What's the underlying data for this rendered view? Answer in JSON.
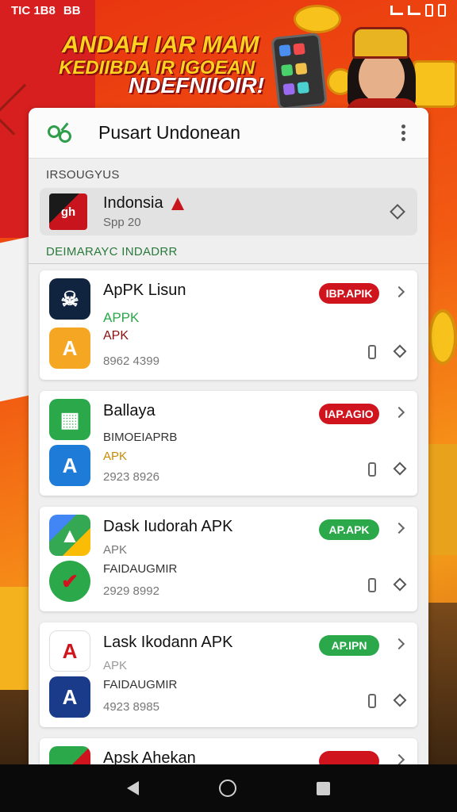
{
  "status_bar": {
    "time": "TIC 1B8",
    "extra": "BB"
  },
  "banner": {
    "line1": "ANDAH IAR MAM",
    "line2": "KEDIIBDA IR IGOEAN",
    "line3": "NDEFNIIOIR!"
  },
  "header": {
    "title": "Pusart Undonean"
  },
  "section_top": {
    "label": "IRSOUGYUS"
  },
  "featured": {
    "icon_text": "gh",
    "title": "Indonsia",
    "subtitle": "Spp 20"
  },
  "section_list": {
    "label": "DEIMARAYC INDADRR"
  },
  "apps": [
    {
      "title": "ApPK Lisun",
      "line1": "APPK",
      "line2": "APK",
      "meta": "8962 4399",
      "badge": "IBP.APIK"
    },
    {
      "title": "Ballaya",
      "line1": "BIMOEIAPRB",
      "line2": "APK",
      "meta": "2923 8926",
      "badge": "IAP.AGIO"
    },
    {
      "title": "Dask Iudorah APK",
      "line1": "APK",
      "line2": "FAIDAUGMIR",
      "meta": "2929 8992",
      "badge": "AP.APK"
    },
    {
      "title": "Lask Ikodann APK",
      "line1": "APK",
      "line2": "FAIDAUGMIR",
      "meta": "4923 8985",
      "badge": "AP.IPN"
    },
    {
      "title": "Apsk Ahekan",
      "line1": "",
      "line2": "",
      "meta": "",
      "badge": ""
    }
  ],
  "colors": {
    "badge_red": "#d0141e",
    "badge_green": "#2aa84a",
    "accent_green": "#2e9e4b"
  }
}
